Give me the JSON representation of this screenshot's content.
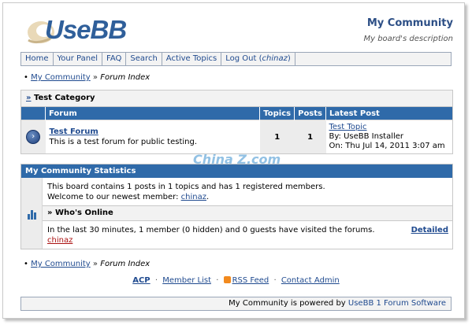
{
  "logo": {
    "text": "UseBB"
  },
  "board": {
    "title": "My Community",
    "description": "My board's description"
  },
  "menu": {
    "home": "Home",
    "your_panel": "Your Panel",
    "faq": "FAQ",
    "search": "Search",
    "active_topics": "Active Topics",
    "logout_prefix": "Log Out (",
    "logout_user": "chinaz",
    "logout_suffix": ")"
  },
  "breadcrumb": {
    "marker": "•",
    "board": "My Community",
    "separator": "»",
    "current": "Forum Index"
  },
  "category": {
    "marker": "»",
    "name": "Test Category",
    "columns": {
      "forum": "Forum",
      "topics": "Topics",
      "posts": "Posts",
      "latest": "Latest Post"
    },
    "forums": [
      {
        "name": "Test Forum",
        "description": "This is a test forum for public testing.",
        "topics": "1",
        "posts": "1",
        "latest_topic": "Test Topic",
        "latest_by": "By: UseBB Installer",
        "latest_on": "On: Thu Jul 14, 2011 3:07 am"
      }
    ]
  },
  "stats": {
    "title": "My Community Statistics",
    "line1": "This board contains 1 posts in 1 topics and has 1 registered members.",
    "welcome_prefix": "Welcome to our newest member: ",
    "newest_member": "chinaz",
    "welcome_suffix": ".",
    "whos_online_title": "» Who's Online",
    "online_line": "In the last 30 minutes, 1 member (0 hidden) and 0 guests have visited the forums.",
    "detailed": "Detailed",
    "online_user": "chinaz"
  },
  "footer": {
    "acp": "ACP",
    "member_list": "Member List",
    "rss": "RSS Feed",
    "contact": "Contact Admin",
    "powered_prefix": "My Community is powered by ",
    "powered_link": "UseBB 1 Forum Software"
  },
  "watermark": {
    "text": "China Z.com"
  },
  "colors": {
    "accent": "#2f6aa9",
    "link": "#1f4a8f",
    "online_user": "#aa1111"
  }
}
